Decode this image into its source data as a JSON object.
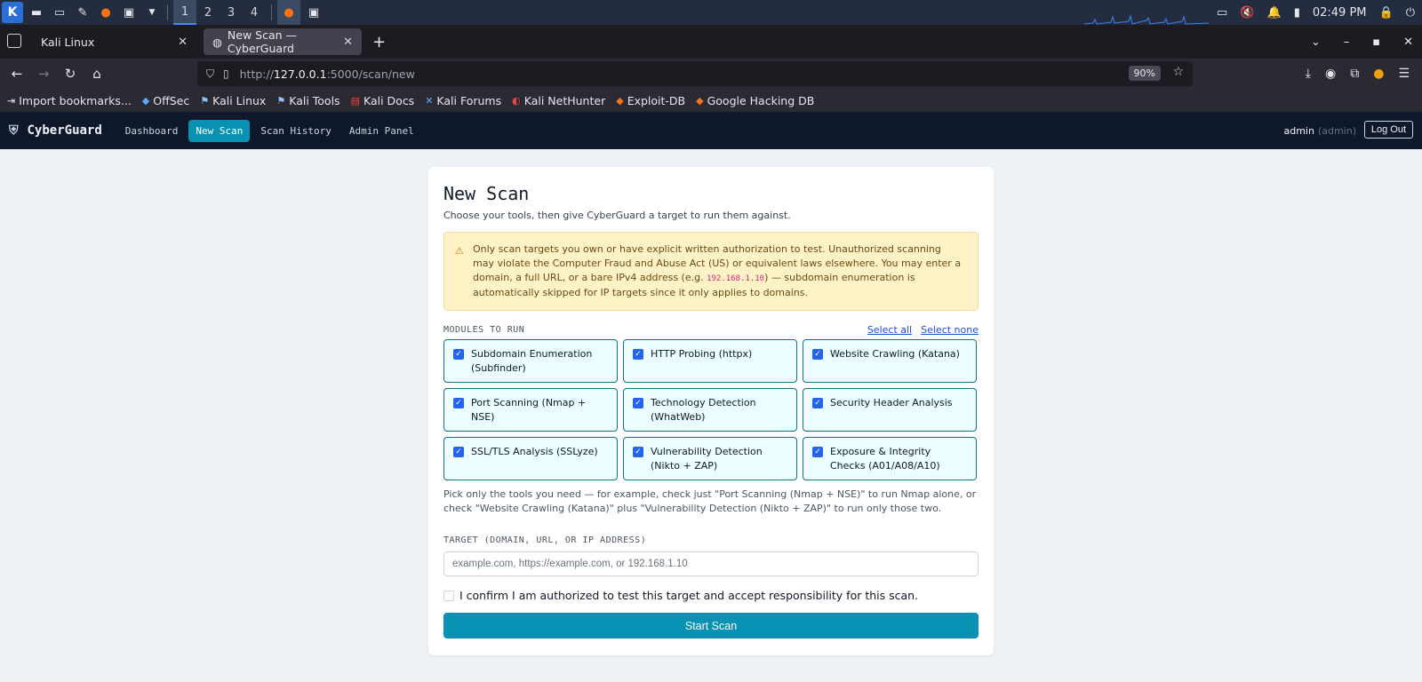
{
  "os_panel": {
    "workspaces": [
      "1",
      "2",
      "3",
      "4"
    ],
    "clock": "02:49 PM"
  },
  "browser": {
    "tabs": [
      {
        "label": "Kali Linux"
      },
      {
        "label": "New Scan — CyberGuard"
      }
    ],
    "url_prefix": "http://",
    "url_host": "127.0.0.1",
    "url_rest": ":5000/scan/new",
    "zoom": "90%",
    "bookmarks": [
      {
        "label": "Import bookmarks...",
        "icon": "import-icon"
      },
      {
        "label": "OffSec",
        "icon": "offsec-icon"
      },
      {
        "label": "Kali Linux",
        "icon": "kali-icon"
      },
      {
        "label": "Kali Tools",
        "icon": "kali-icon"
      },
      {
        "label": "Kali Docs",
        "icon": "docs-icon"
      },
      {
        "label": "Kali Forums",
        "icon": "forums-icon"
      },
      {
        "label": "Kali NetHunter",
        "icon": "nethunter-icon"
      },
      {
        "label": "Exploit-DB",
        "icon": "exploitdb-icon"
      },
      {
        "label": "Google Hacking DB",
        "icon": "ghdb-icon"
      }
    ]
  },
  "app": {
    "brand": "CyberGuard",
    "nav": [
      "Dashboard",
      "New Scan",
      "Scan History",
      "Admin Panel"
    ],
    "user": "admin",
    "role": "(admin)",
    "logout": "Log Out"
  },
  "page": {
    "title": "New Scan",
    "subtitle": "Choose your tools, then give CyberGuard a target to run them against.",
    "warning_before": "Only scan targets you own or have explicit written authorization to test. Unauthorized scanning may violate the Computer Fraud and Abuse Act (US) or equivalent laws elsewhere. You may enter a domain, a full URL, or a bare IPv4 address (e.g. ",
    "warning_code": "192.168.1.10",
    "warning_after": ") — subdomain enumeration is automatically skipped for IP targets since it only applies to domains.",
    "modules_label": "MODULES TO RUN",
    "select_all": "Select all",
    "select_none": "Select none",
    "modules": [
      "Subdomain Enumeration (Subfinder)",
      "HTTP Probing (httpx)",
      "Website Crawling (Katana)",
      "Port Scanning (Nmap + NSE)",
      "Technology Detection (WhatWeb)",
      "Security Header Analysis",
      "SSL/TLS Analysis (SSLyze)",
      "Vulnerability Detection (Nikto + ZAP)",
      "Exposure & Integrity Checks (A01/A08/A10)"
    ],
    "hint": "Pick only the tools you need — for example, check just \"Port Scanning (Nmap + NSE)\" to run Nmap alone, or check \"Website Crawling (Katana)\" plus \"Vulnerability Detection (Nikto + ZAP)\" to run only those two.",
    "target_label": "TARGET (DOMAIN, URL, OR IP ADDRESS)",
    "target_placeholder": "example.com, https://example.com, or 192.168.1.10",
    "confirm_label": "I confirm I am authorized to test this target and accept responsibility for this scan.",
    "start_button": "Start Scan"
  }
}
